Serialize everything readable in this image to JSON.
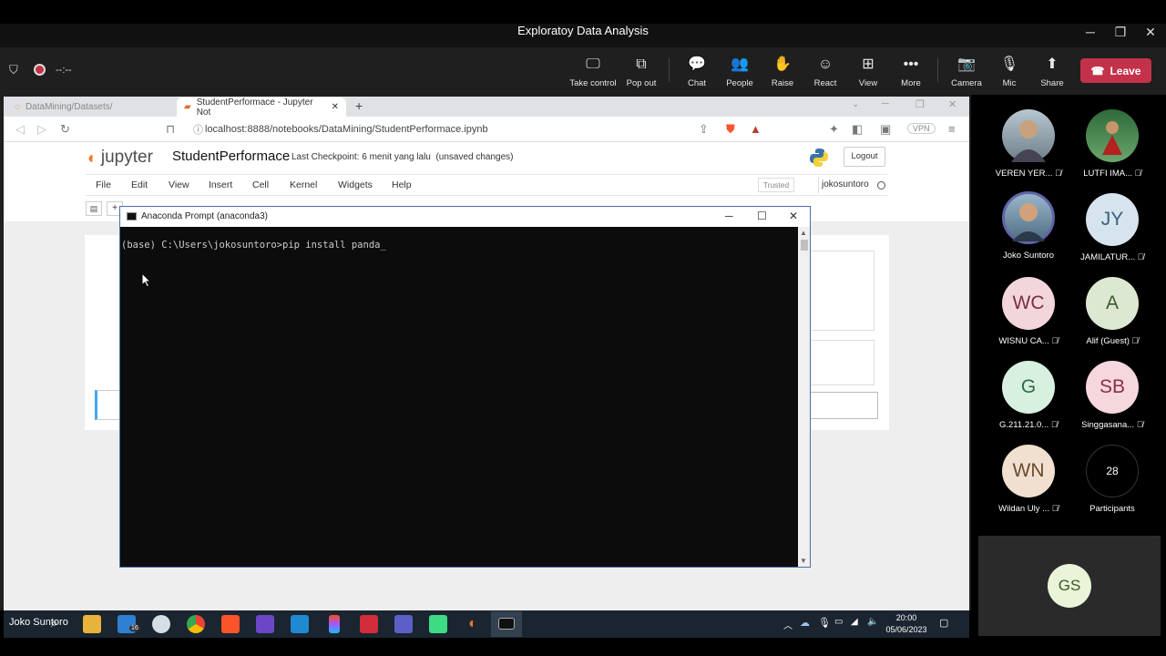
{
  "meeting": {
    "title": "Exploratoy Data Analysis",
    "timer": "--:--"
  },
  "toolbar": {
    "items": [
      {
        "label": "Take control",
        "icon": "take-control-icon"
      },
      {
        "label": "Pop out",
        "icon": "pop-out-icon"
      },
      {
        "label": "Chat",
        "icon": "chat-icon"
      },
      {
        "label": "People",
        "icon": "people-icon"
      },
      {
        "label": "Raise",
        "icon": "raise-hand-icon"
      },
      {
        "label": "React",
        "icon": "react-icon"
      },
      {
        "label": "View",
        "icon": "view-icon"
      },
      {
        "label": "More",
        "icon": "more-icon"
      },
      {
        "label": "Camera",
        "icon": "camera-off-icon"
      },
      {
        "label": "Mic",
        "icon": "mic-off-icon"
      },
      {
        "label": "Share",
        "icon": "share-icon"
      }
    ],
    "leave_label": "Leave",
    "leave_color": "#c4314b"
  },
  "browser": {
    "tabs": [
      {
        "label": "DataMining/Datasets/"
      },
      {
        "label": "StudentPerformace - Jupyter Not"
      }
    ],
    "url": "localhost:8888/notebooks/DataMining/StudentPerformace.ipynb",
    "vpn": "VPN"
  },
  "jupyter": {
    "logo_text": "jupyter",
    "notebook_title": "StudentPerformace",
    "checkpoint": "Last Checkpoint: 6 menit yang lalu",
    "unsaved": "(unsaved changes)",
    "logout": "Logout",
    "menu": [
      "File",
      "Edit",
      "View",
      "Insert",
      "Cell",
      "Kernel",
      "Widgets",
      "Help"
    ],
    "trusted": "Trusted",
    "user": "jokosuntoro"
  },
  "cmd": {
    "title": "Anaconda Prompt (anaconda3)",
    "line": "(base) C:\\Users\\jokosuntoro>pip install panda_"
  },
  "taskbar": {
    "presenter": "Joko Suntoro",
    "mail_badge": "16",
    "time": "20:00",
    "date": "05/06/2023"
  },
  "participants": [
    {
      "name": "VEREN YER...",
      "initials": "",
      "photo": true,
      "muted": true
    },
    {
      "name": "LUTFI IMA...",
      "initials": "",
      "photo": true,
      "muted": true
    },
    {
      "name": "Joko Suntoro",
      "initials": "",
      "photo": true,
      "muted": false
    },
    {
      "name": "JAMILATUR...",
      "initials": "JY",
      "muted": true,
      "color": "#d6e4ee",
      "text_color": "#3b5f7d"
    },
    {
      "name": "WISNU CA...",
      "initials": "WC",
      "muted": true,
      "color": "#f3d6dc",
      "text_color": "#7b2f44"
    },
    {
      "name": "Alif (Guest)",
      "initials": "A",
      "muted": true,
      "color": "#dde8d3",
      "text_color": "#3f5c2c"
    },
    {
      "name": "G.211.21.0...",
      "initials": "G",
      "muted": true,
      "color": "#d7f0df",
      "text_color": "#2f6a44"
    },
    {
      "name": "Singgasana...",
      "initials": "SB",
      "muted": true,
      "color": "#f6d7dd",
      "text_color": "#8a2f45"
    },
    {
      "name": "Wildan Uly ...",
      "initials": "WN",
      "muted": true,
      "color": "#f1e0d0",
      "text_color": "#6b4a2f"
    },
    {
      "name": "Participants",
      "initials": "28",
      "muted": false,
      "color": "#000000",
      "text_color": "#ffffff"
    }
  ],
  "self_tile": {
    "initials": "GS",
    "color": "#eaf4d8",
    "text_color": "#44562b"
  }
}
